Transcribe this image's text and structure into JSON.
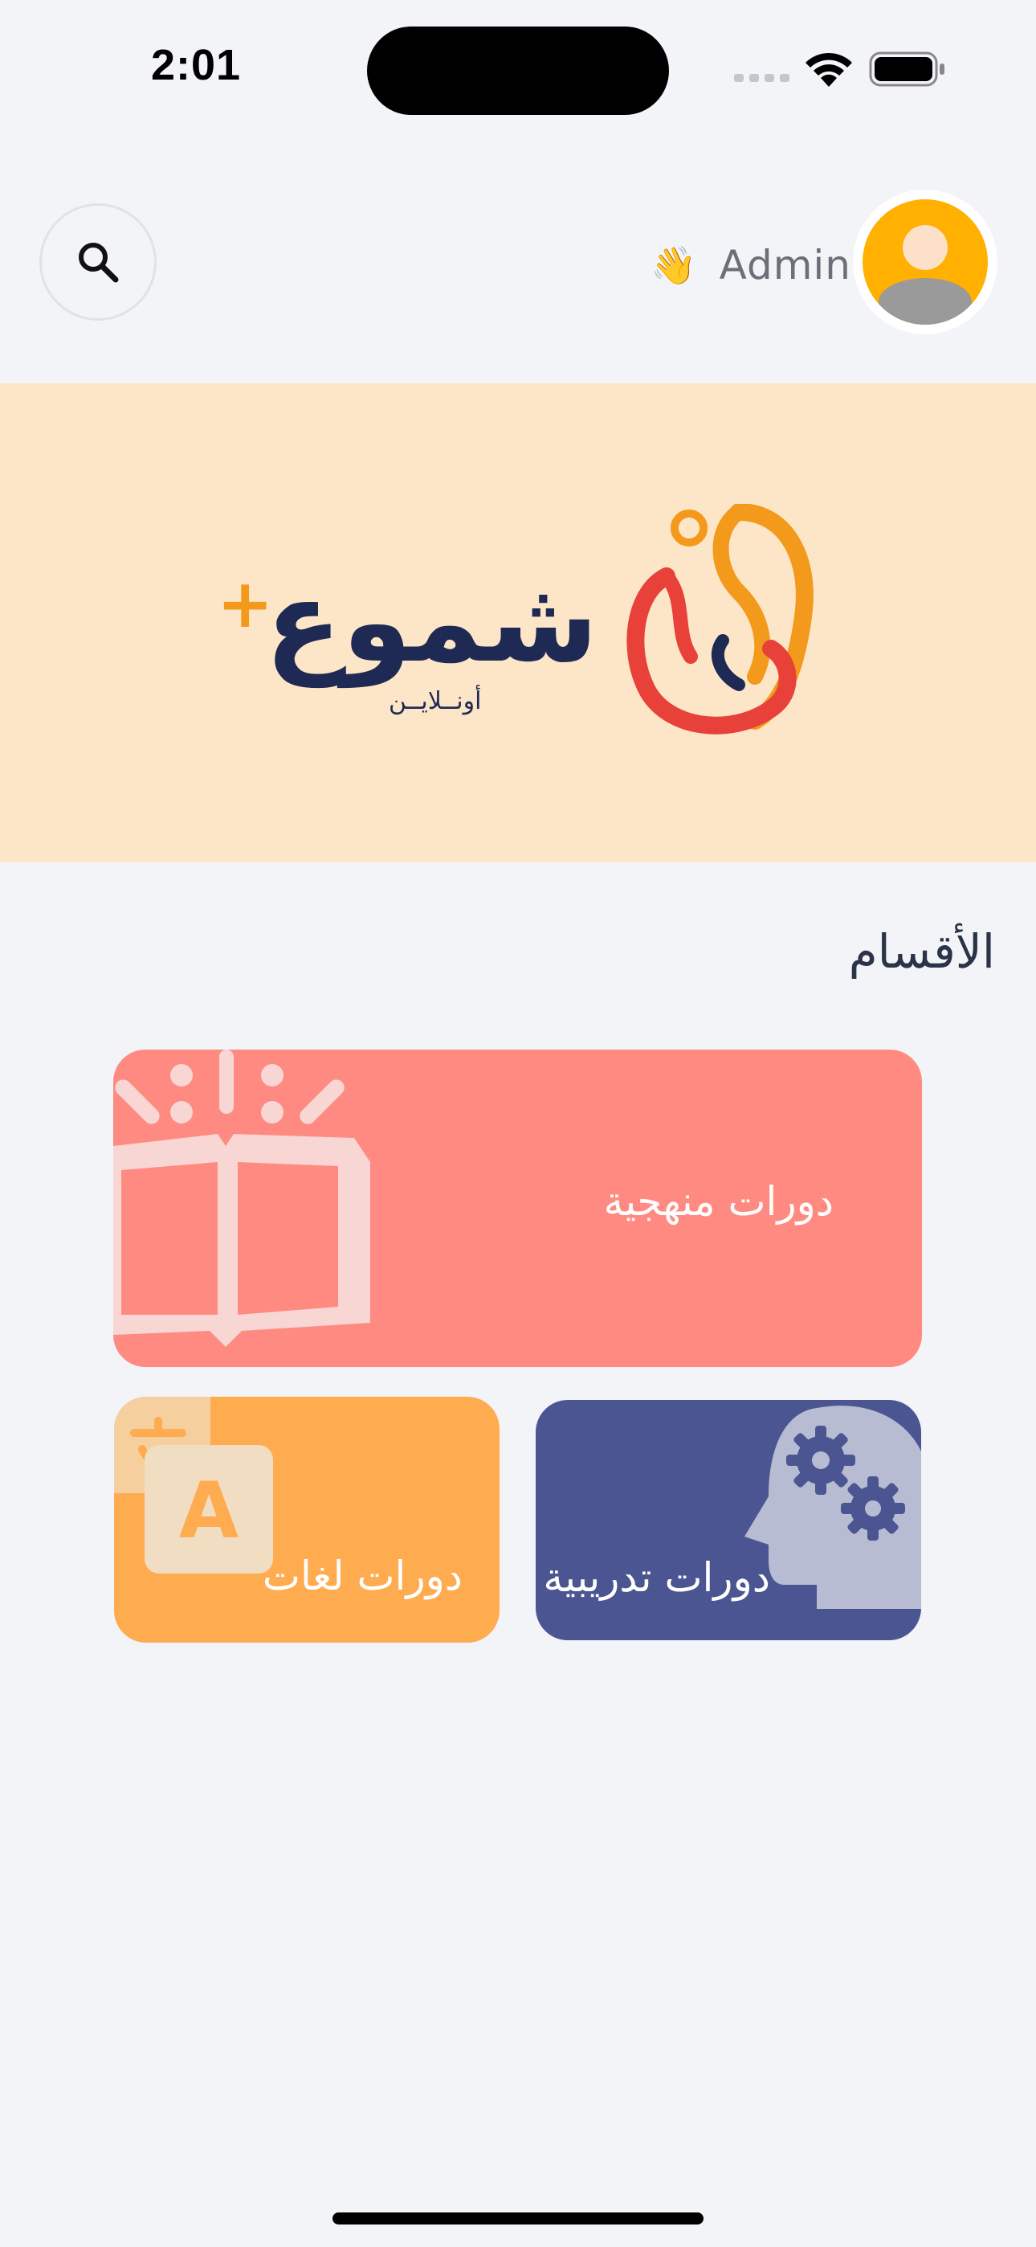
{
  "status_bar": {
    "time": "2:01"
  },
  "header": {
    "greeting_name": "Admin",
    "greeting_emoji": "👋",
    "search_icon": "search-icon",
    "avatar_icon": "user-avatar-icon"
  },
  "banner": {
    "brand_name": "شموع",
    "brand_plus": "+",
    "brand_subtitle": "أونــلايــن"
  },
  "sections": {
    "title": "الأقسام",
    "items": [
      {
        "label": "دورات منهجية",
        "icon": "book-icon",
        "color": "#ff8a82"
      },
      {
        "label": "دورات تدريبية",
        "icon": "head-gears-icon",
        "color": "#4b5591"
      },
      {
        "label": "دورات لغات",
        "icon": "translate-icon",
        "color": "#ffab4f"
      }
    ]
  },
  "colors": {
    "background": "#f3f4f8",
    "banner": "#fde6c8",
    "brand_navy": "#1f2a54",
    "brand_orange": "#f39a1c",
    "brand_red": "#e8413a",
    "avatar": "#ffb000"
  }
}
